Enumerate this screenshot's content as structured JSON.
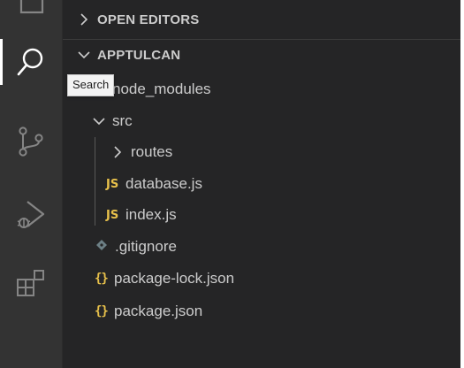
{
  "activity_bar": {
    "items": [
      {
        "name": "explorer",
        "icon": "files-icon"
      },
      {
        "name": "search",
        "icon": "search-icon"
      },
      {
        "name": "source-control",
        "icon": "source-control-icon"
      },
      {
        "name": "run-and-debug",
        "icon": "run-debug-icon"
      },
      {
        "name": "extensions",
        "icon": "extensions-icon"
      }
    ],
    "active": "search"
  },
  "tooltip": {
    "text": "Search"
  },
  "explorer": {
    "open_editors_label": "OPEN EDITORS",
    "folder_label": "APPTULCAN",
    "tree": [
      {
        "label": "node_modules",
        "type": "folder",
        "expanded": false
      },
      {
        "label": "src",
        "type": "folder",
        "expanded": true
      },
      {
        "label": "routes",
        "type": "folder",
        "expanded": false
      },
      {
        "label": "database.js",
        "type": "js",
        "badge": "JS"
      },
      {
        "label": "index.js",
        "type": "js",
        "badge": "JS"
      },
      {
        "label": ".gitignore",
        "type": "git"
      },
      {
        "label": "package-lock.json",
        "type": "json",
        "badge": "{}"
      },
      {
        "label": "package.json",
        "type": "json",
        "badge": "{}"
      }
    ]
  },
  "colors": {
    "activity_bar_bg": "#333333",
    "sidebar_bg": "#252526",
    "text": "#cccccc",
    "js_badge": "#e8c14b",
    "git_icon": "#6d8086"
  }
}
